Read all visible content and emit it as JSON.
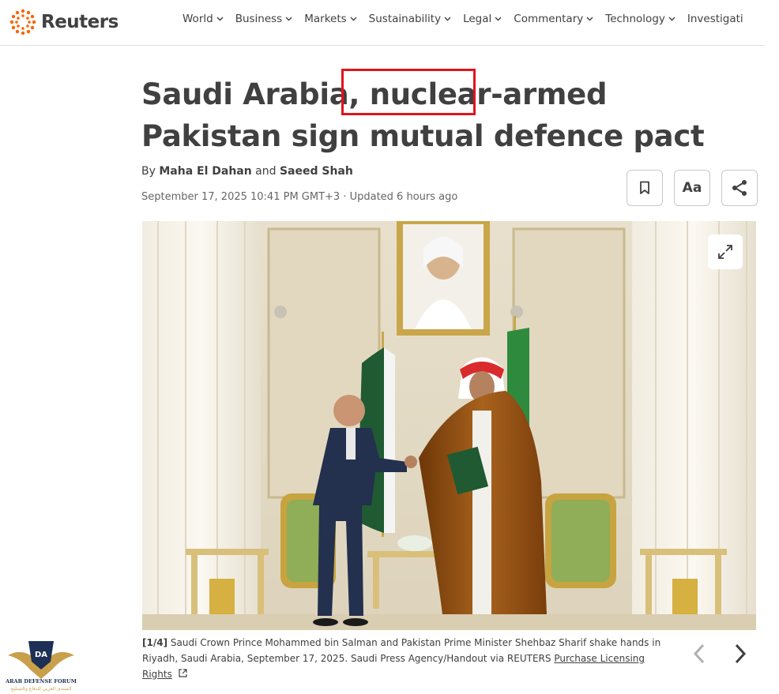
{
  "brand": {
    "name": "Reuters",
    "accent": "#fa6400"
  },
  "nav": {
    "items": [
      "World",
      "Business",
      "Markets",
      "Sustainability",
      "Legal",
      "Commentary",
      "Technology",
      "Investigati"
    ]
  },
  "article": {
    "headline": "Saudi Arabia, nuclear-armed Pakistan sign mutual defence pact",
    "byline_prefix": "By",
    "author1": "Maha El Dahan",
    "byline_and": "and",
    "author2": "Saeed Shah",
    "dateline": "September 17, 2025 10:41 PM GMT+3 · Updated 6 hours ago",
    "tools": {
      "bookmark_icon": "bookmark-icon",
      "text_size_label": "Aa",
      "share_icon": "share-icon"
    }
  },
  "image": {
    "counter": "[1/4]",
    "caption": " Saudi Crown Prince Mohammed bin Salman and Pakistan Prime Minister Shehbaz Sharif shake hands in Riyadh, Saudi Arabia, September 17, 2025. Saudi Press Agency/Handout via REUTERS ",
    "licensing_link": "Purchase Licensing Rights",
    "expand_icon": "expand-icon"
  },
  "carousel": {
    "prev_icon": "chevron-left-icon",
    "next_icon": "chevron-right-icon"
  },
  "watermark": {
    "text_en": "ARAB DEFENSE FORUM",
    "text_ar": "المنتدى العربي للدفاع والتسليح",
    "mark": "DA"
  },
  "colors": {
    "text": "#404040",
    "highlight_box": "#e0141e",
    "pakistan_green": "#1f5a32",
    "saudi_green": "#2e8b3e",
    "robe_brown": "#8a4a12"
  }
}
